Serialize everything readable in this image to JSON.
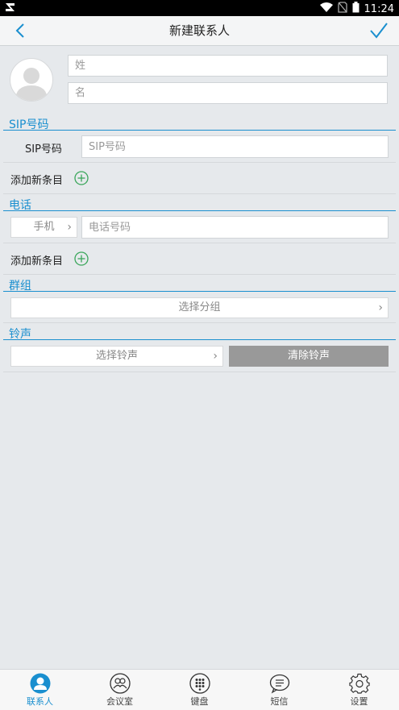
{
  "status": {
    "time": "11:24"
  },
  "header": {
    "title": "新建联系人"
  },
  "name": {
    "last_placeholder": "姓",
    "first_placeholder": "名"
  },
  "sip": {
    "section_title": "SIP号码",
    "field_label": "SIP号码",
    "placeholder": "SIP号码",
    "add_label": "添加新条目"
  },
  "phone": {
    "section_title": "电话",
    "type_value": "手机",
    "placeholder": "电话号码",
    "add_label": "添加新条目"
  },
  "group": {
    "section_title": "群组",
    "select_label": "选择分组"
  },
  "ringtone": {
    "section_title": "铃声",
    "select_label": "选择铃声",
    "clear_label": "清除铃声"
  },
  "colors": {
    "accent": "#1a8fcf",
    "add_green": "#3aa65b"
  },
  "nav": {
    "items": [
      {
        "label": "联系人",
        "icon": "person-icon"
      },
      {
        "label": "会议室",
        "icon": "meeting-room-icon"
      },
      {
        "label": "键盘",
        "icon": "dialpad-icon"
      },
      {
        "label": "短信",
        "icon": "message-icon"
      },
      {
        "label": "设置",
        "icon": "gear-icon"
      }
    ],
    "active_index": 0
  }
}
